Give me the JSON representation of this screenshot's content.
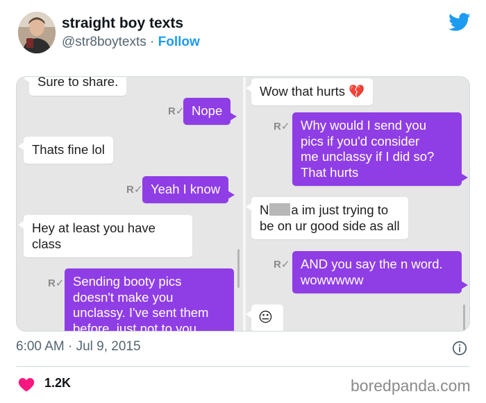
{
  "author": {
    "display_name": "straight boy texts",
    "handle": "@str8boytexts",
    "separator": "·",
    "follow_label": "Follow"
  },
  "icons": {
    "brand": "twitter-bird-icon",
    "heart": "heart-icon",
    "info": "info-icon",
    "read_receipt": "read-receipt-icon"
  },
  "colors": {
    "accent": "#1d9bf0",
    "outgoing_bubble": "#8f3ee6",
    "like": "#f91880"
  },
  "read_mark": "R✓",
  "left_panel": {
    "messages": [
      {
        "dir": "in",
        "text": "Sure to share."
      },
      {
        "dir": "out",
        "text": "Nope"
      },
      {
        "dir": "in",
        "text": "Thats fine lol"
      },
      {
        "dir": "out",
        "text": "Yeah I know"
      },
      {
        "dir": "in",
        "lines": [
          "Hey at least you have",
          "class"
        ]
      },
      {
        "dir": "out",
        "lines": [
          "Sending booty pics",
          "doesn't make you",
          "unclassy. I've sent them",
          "before, just not to you"
        ]
      }
    ]
  },
  "right_panel": {
    "messages": [
      {
        "dir": "in",
        "text": "Wow that hurts",
        "emoji": "💔"
      },
      {
        "dir": "out",
        "lines": [
          "Why would I send you",
          "pics if you'd consider",
          "me unclassy if I did so?",
          "That hurts"
        ]
      },
      {
        "dir": "in",
        "line1_start": "N",
        "line1_end": "a im just trying to",
        "line2": "be on ur good side as all"
      },
      {
        "dir": "out",
        "lines": [
          "AND you say the n word.",
          "wowwwww"
        ]
      },
      {
        "dir": "in",
        "emoji": "😐"
      }
    ]
  },
  "timestamp": "6:00 AM · Jul 9, 2015",
  "likes": "1.2K",
  "watermark": "boredpanda.com"
}
